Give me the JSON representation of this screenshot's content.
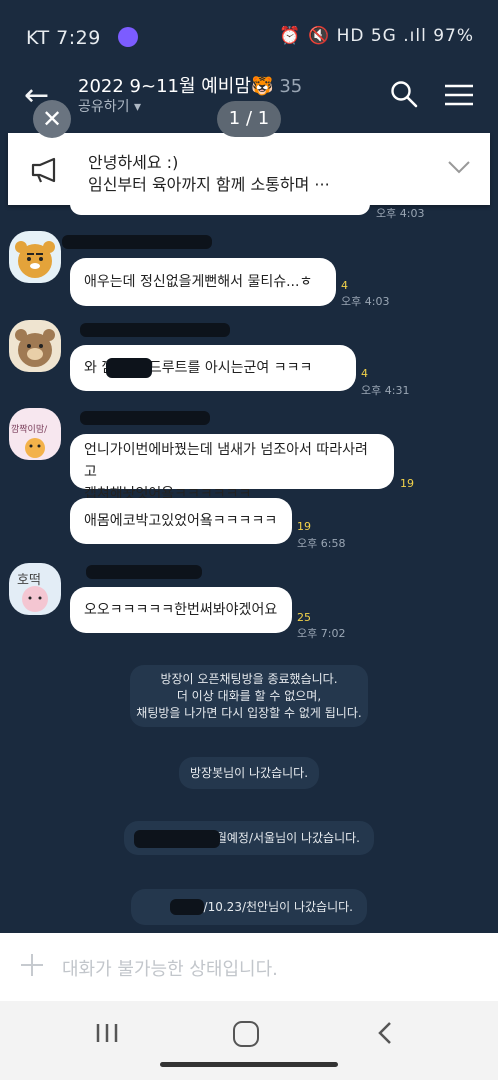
{
  "status_bar": {
    "left": "KT 7:29",
    "right": "⏰ 🔇 HD 5G .ıll 97%"
  },
  "header": {
    "title": "2022 9~11월 예비맘",
    "title_emoji": "🐯",
    "member_count": "35",
    "share_label": "공유하기 ▾"
  },
  "overlay": {
    "close_glyph": "✕",
    "page_indicator": "1 / 1"
  },
  "notice": {
    "line1": "안녕하세요 :)",
    "line2": "임신부터 육아까지 함께 소통하며 ···"
  },
  "messages": [
    {
      "text": "",
      "time": "오후 4:03"
    },
    {
      "avatar": "ryan",
      "text": "애우는데 정신없을게뻔해서 물티슈...ㅎㅎ",
      "unread": "4",
      "time": "오후 4:03"
    },
    {
      "avatar": "bear",
      "text": "와 깜  님 레드루트를 아시는군여 ㅋㅋㅋ",
      "unread": "4",
      "time": "오후 4:31"
    },
    {
      "avatar": "kkampak",
      "avatar_text": "깜짝이맘/",
      "text_line1": "언니가이번에바꿨는데 냄새가 넘조아서 따라사려고",
      "text_line2": "캡쳐해놧엇어욬ㅋㅋㅋㅋㅋㅋ",
      "unread": "19"
    },
    {
      "text": "애몸에코박고있었어욬ㅋㅋㅋㅋㅋ",
      "unread": "19",
      "time": "오후 6:58"
    },
    {
      "avatar": "hotteok",
      "avatar_text": "호떡",
      "text": "오오ㅋㅋㅋㅋㅋ한번써봐야겠어요",
      "unread": "25",
      "time": "오후 7:02"
    }
  ],
  "system": [
    {
      "l1": "방장이 오픈채팅방을 종료했습니다.",
      "l2": "더 이상 대화를 할 수 없으며,",
      "l3": "채팅방을 나가면 다시 입장할 수 없게 됩니다."
    },
    {
      "text": "방장봇님이 나갔습니다."
    },
    {
      "text": "/11월예정/서울님이 나갔습니다."
    },
    {
      "text": "3/10.23/천안님이 나갔습니다."
    }
  ],
  "input": {
    "placeholder": "대화가 불가능한 상태입니다."
  },
  "colors": {
    "background": "#1a2a3e",
    "bubble": "#ffffff",
    "unread": "#f2d24a"
  }
}
